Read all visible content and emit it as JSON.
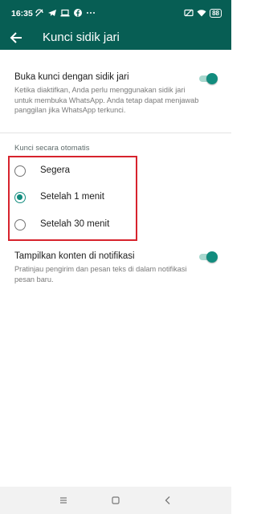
{
  "status_bar": {
    "time": "16:35",
    "battery": "88",
    "icons": [
      "nfc-off-icon",
      "telegram-icon",
      "laptop-icon",
      "facebook-icon",
      "more-dots-icon",
      "sim-off-icon",
      "wifi-icon",
      "battery-icon"
    ]
  },
  "app_bar": {
    "title": "Kunci sidik jari",
    "back_icon": "arrow-back-icon"
  },
  "fingerprint_setting": {
    "title": "Buka kunci dengan sidik jari",
    "description": "Ketika diaktifkan, Anda perlu menggunakan sidik jari untuk membuka WhatsApp. Anda tetap dapat menjawab panggilan jika WhatsApp terkunci.",
    "enabled": true
  },
  "auto_lock": {
    "section_title": "Kunci secara otomatis",
    "options": [
      {
        "label": "Segera",
        "selected": false
      },
      {
        "label": "Setelah 1 menit",
        "selected": true
      },
      {
        "label": "Setelah 30 menit",
        "selected": false
      }
    ]
  },
  "notification_setting": {
    "title": "Tampilkan konten di notifikasi",
    "description": "Pratinjau pengirim dan pesan teks di dalam notifikasi pesan baru.",
    "enabled": true
  },
  "colors": {
    "primary": "#075e54",
    "accent": "#128c7e",
    "highlight_border": "#d7232d"
  },
  "nav_bar": {
    "buttons": [
      "menu-icon",
      "home-square-icon",
      "back-chevron-icon"
    ]
  }
}
